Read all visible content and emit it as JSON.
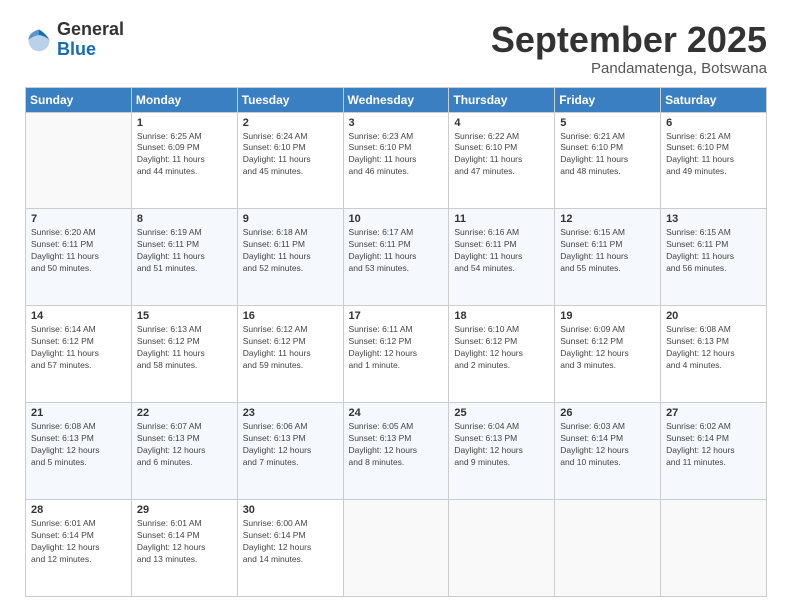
{
  "logo": {
    "general": "General",
    "blue": "Blue"
  },
  "header": {
    "month": "September 2025",
    "location": "Pandamatenga, Botswana"
  },
  "days_of_week": [
    "Sunday",
    "Monday",
    "Tuesday",
    "Wednesday",
    "Thursday",
    "Friday",
    "Saturday"
  ],
  "weeks": [
    [
      {
        "day": "",
        "info": ""
      },
      {
        "day": "1",
        "info": "Sunrise: 6:25 AM\nSunset: 6:09 PM\nDaylight: 11 hours\nand 44 minutes."
      },
      {
        "day": "2",
        "info": "Sunrise: 6:24 AM\nSunset: 6:10 PM\nDaylight: 11 hours\nand 45 minutes."
      },
      {
        "day": "3",
        "info": "Sunrise: 6:23 AM\nSunset: 6:10 PM\nDaylight: 11 hours\nand 46 minutes."
      },
      {
        "day": "4",
        "info": "Sunrise: 6:22 AM\nSunset: 6:10 PM\nDaylight: 11 hours\nand 47 minutes."
      },
      {
        "day": "5",
        "info": "Sunrise: 6:21 AM\nSunset: 6:10 PM\nDaylight: 11 hours\nand 48 minutes."
      },
      {
        "day": "6",
        "info": "Sunrise: 6:21 AM\nSunset: 6:10 PM\nDaylight: 11 hours\nand 49 minutes."
      }
    ],
    [
      {
        "day": "7",
        "info": "Sunrise: 6:20 AM\nSunset: 6:11 PM\nDaylight: 11 hours\nand 50 minutes."
      },
      {
        "day": "8",
        "info": "Sunrise: 6:19 AM\nSunset: 6:11 PM\nDaylight: 11 hours\nand 51 minutes."
      },
      {
        "day": "9",
        "info": "Sunrise: 6:18 AM\nSunset: 6:11 PM\nDaylight: 11 hours\nand 52 minutes."
      },
      {
        "day": "10",
        "info": "Sunrise: 6:17 AM\nSunset: 6:11 PM\nDaylight: 11 hours\nand 53 minutes."
      },
      {
        "day": "11",
        "info": "Sunrise: 6:16 AM\nSunset: 6:11 PM\nDaylight: 11 hours\nand 54 minutes."
      },
      {
        "day": "12",
        "info": "Sunrise: 6:15 AM\nSunset: 6:11 PM\nDaylight: 11 hours\nand 55 minutes."
      },
      {
        "day": "13",
        "info": "Sunrise: 6:15 AM\nSunset: 6:11 PM\nDaylight: 11 hours\nand 56 minutes."
      }
    ],
    [
      {
        "day": "14",
        "info": "Sunrise: 6:14 AM\nSunset: 6:12 PM\nDaylight: 11 hours\nand 57 minutes."
      },
      {
        "day": "15",
        "info": "Sunrise: 6:13 AM\nSunset: 6:12 PM\nDaylight: 11 hours\nand 58 minutes."
      },
      {
        "day": "16",
        "info": "Sunrise: 6:12 AM\nSunset: 6:12 PM\nDaylight: 11 hours\nand 59 minutes."
      },
      {
        "day": "17",
        "info": "Sunrise: 6:11 AM\nSunset: 6:12 PM\nDaylight: 12 hours\nand 1 minute."
      },
      {
        "day": "18",
        "info": "Sunrise: 6:10 AM\nSunset: 6:12 PM\nDaylight: 12 hours\nand 2 minutes."
      },
      {
        "day": "19",
        "info": "Sunrise: 6:09 AM\nSunset: 6:12 PM\nDaylight: 12 hours\nand 3 minutes."
      },
      {
        "day": "20",
        "info": "Sunrise: 6:08 AM\nSunset: 6:13 PM\nDaylight: 12 hours\nand 4 minutes."
      }
    ],
    [
      {
        "day": "21",
        "info": "Sunrise: 6:08 AM\nSunset: 6:13 PM\nDaylight: 12 hours\nand 5 minutes."
      },
      {
        "day": "22",
        "info": "Sunrise: 6:07 AM\nSunset: 6:13 PM\nDaylight: 12 hours\nand 6 minutes."
      },
      {
        "day": "23",
        "info": "Sunrise: 6:06 AM\nSunset: 6:13 PM\nDaylight: 12 hours\nand 7 minutes."
      },
      {
        "day": "24",
        "info": "Sunrise: 6:05 AM\nSunset: 6:13 PM\nDaylight: 12 hours\nand 8 minutes."
      },
      {
        "day": "25",
        "info": "Sunrise: 6:04 AM\nSunset: 6:13 PM\nDaylight: 12 hours\nand 9 minutes."
      },
      {
        "day": "26",
        "info": "Sunrise: 6:03 AM\nSunset: 6:14 PM\nDaylight: 12 hours\nand 10 minutes."
      },
      {
        "day": "27",
        "info": "Sunrise: 6:02 AM\nSunset: 6:14 PM\nDaylight: 12 hours\nand 11 minutes."
      }
    ],
    [
      {
        "day": "28",
        "info": "Sunrise: 6:01 AM\nSunset: 6:14 PM\nDaylight: 12 hours\nand 12 minutes."
      },
      {
        "day": "29",
        "info": "Sunrise: 6:01 AM\nSunset: 6:14 PM\nDaylight: 12 hours\nand 13 minutes."
      },
      {
        "day": "30",
        "info": "Sunrise: 6:00 AM\nSunset: 6:14 PM\nDaylight: 12 hours\nand 14 minutes."
      },
      {
        "day": "",
        "info": ""
      },
      {
        "day": "",
        "info": ""
      },
      {
        "day": "",
        "info": ""
      },
      {
        "day": "",
        "info": ""
      }
    ]
  ]
}
